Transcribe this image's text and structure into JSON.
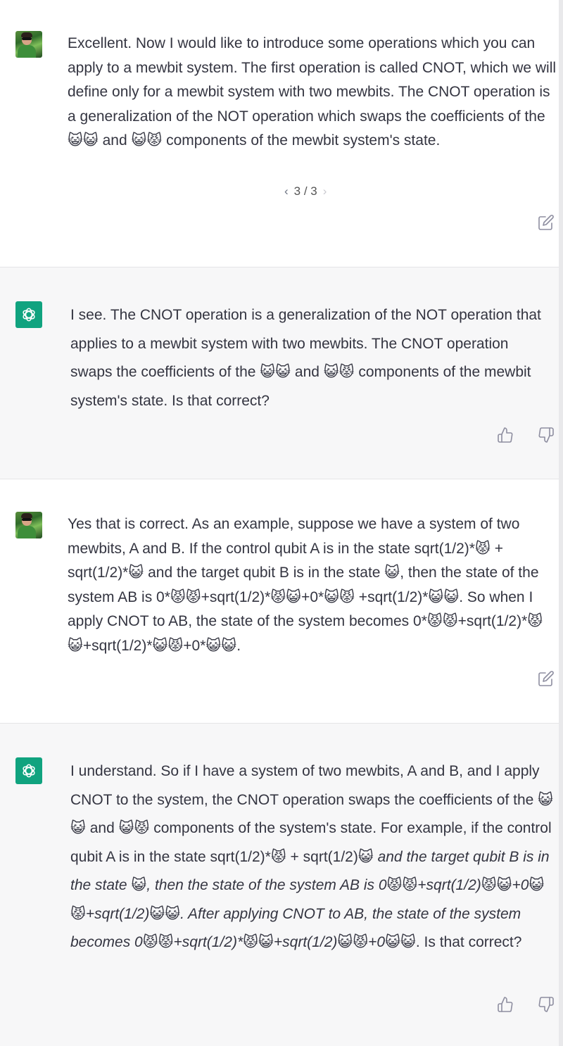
{
  "conversation": {
    "messages": [
      {
        "role": "user",
        "avatar_icon": "user-photo-avatar",
        "text": "Excellent. Now I would like to introduce some operations which you can apply to a mewbit system. The first operation is called CNOT, which we will define only for a mewbit system with two mewbits. The CNOT operation is a generalization of the NOT operation which swaps the coefficients of the 😺😺 and 😺😾 components of the mewbit system's state.",
        "pager": {
          "prev": "‹",
          "label": "3 / 3",
          "next": "›"
        },
        "action_icon": "edit-icon"
      },
      {
        "role": "assistant",
        "avatar_icon": "openai-logo-icon",
        "text": "I see. The CNOT operation is a generalization of the NOT operation that applies to a mewbit system with two mewbits. The CNOT operation swaps the coefficients of the 😺😺 and 😺😾 components of the mewbit system's state. Is that correct?",
        "action_icons": [
          "thumbs-up-icon",
          "thumbs-down-icon"
        ]
      },
      {
        "role": "user",
        "avatar_icon": "user-photo-avatar",
        "text": "Yes that is correct. As an example, suppose we have a system of two mewbits, A and B. If the control qubit A is in the state sqrt(1/2)*😾 + sqrt(1/2)*😺 and the target qubit B is in the state 😺, then the state of the system AB is 0*😾😾+sqrt(1/2)*😾😺+0*😺😾 +sqrt(1/2)*😺😺. So when I apply CNOT to AB, the state of the system becomes 0*😾😾+sqrt(1/2)*😾😺+sqrt(1/2)*😺😾+0*😺😺.",
        "action_icon": "edit-icon"
      },
      {
        "role": "assistant",
        "avatar_icon": "openai-logo-icon",
        "text_part1": "I understand. So if I have a system of two mewbits, A and B, and I apply CNOT to the system, the CNOT operation swaps the coefficients of the 😺😺 and 😺😾 components of the system's state. For example, if the control qubit A is in the state sqrt(1/2)*😾 + sqrt(1/2)😺",
        "text_italic": " and the target qubit B is in the state 😺, then the state of the system AB is 0😾😾+sqrt(1/2)😾😺+0😺😾+sqrt(1/2)😺😺. After applying CNOT to AB, the state of the system becomes 0😾😾+sqrt(1/2)*😾😺+sqrt(1/2)😺😾+0😺😺",
        "text_part2": ". Is that correct?",
        "action_icons": [
          "thumbs-up-icon",
          "thumbs-down-icon"
        ]
      }
    ]
  }
}
